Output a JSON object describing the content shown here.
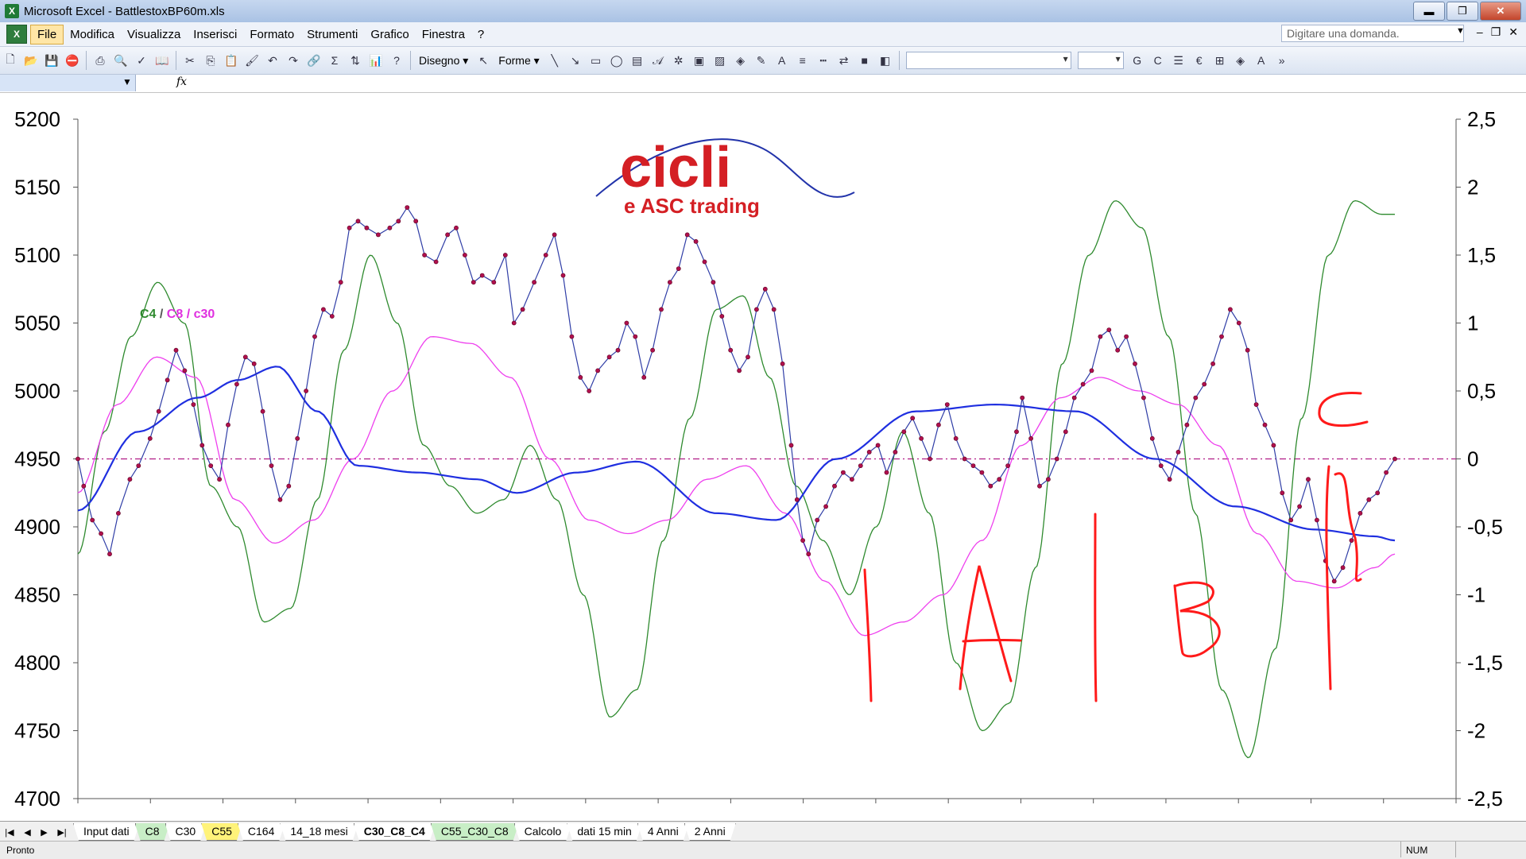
{
  "window": {
    "title": "Microsoft Excel - BattlestoxBP60m.xls",
    "app_icon": "excel-icon",
    "buttons": {
      "minimize": "▬",
      "restore": "❐",
      "close": "✕"
    }
  },
  "menu": {
    "items": [
      "File",
      "Modifica",
      "Visualizza",
      "Inserisci",
      "Formato",
      "Strumenti",
      "Grafico",
      "Finestra",
      "?"
    ],
    "active": "File",
    "ask_placeholder": "Digitare una domanda.",
    "mdi": {
      "minimize": "–",
      "restore": "❐",
      "close": "✕"
    }
  },
  "toolbar": {
    "disegno": "Disegno ▾",
    "forme": "Forme ▾",
    "bold": "G",
    "italic": "C",
    "euro": "€"
  },
  "formula_bar": {
    "fx": "fx"
  },
  "chart_data": {
    "type": "line",
    "logo": {
      "big": "cicli",
      "small": "e ASC trading"
    },
    "legend": {
      "c4": "C4",
      "slash1": " / ",
      "c8": "C8",
      "slash2": " / ",
      "c30": "c30"
    },
    "y_left": {
      "min": 4700,
      "max": 5200,
      "ticks": [
        "5200",
        "5150",
        "5100",
        "5050",
        "5000",
        "4950",
        "4900",
        "4850",
        "4800",
        "4750",
        "4700"
      ]
    },
    "y_right": {
      "min": -2.5,
      "max": 2.5,
      "ticks": [
        "2,5",
        "2",
        "1,5",
        "1",
        "0,5",
        "0",
        "-0,5",
        "-1",
        "-1,5",
        "-2",
        "-2,5"
      ]
    },
    "x_count": 19,
    "colors": {
      "price": "#2f3da6",
      "marker": "#b0104d",
      "c4": "#2e8a2e",
      "c8": "#ee3fee",
      "c30": "#1f2fe0",
      "zero": "#b11b86",
      "annot": "#ff1a1a"
    },
    "annotations": {
      "a": "A",
      "b": "B",
      "c": "C"
    },
    "price_keyframes": [
      [
        0,
        4950
      ],
      [
        2,
        4930
      ],
      [
        5,
        4905
      ],
      [
        8,
        4895
      ],
      [
        11,
        4880
      ],
      [
        14,
        4910
      ],
      [
        18,
        4935
      ],
      [
        21,
        4945
      ],
      [
        25,
        4965
      ],
      [
        28,
        4985
      ],
      [
        31,
        5008
      ],
      [
        34,
        5030
      ],
      [
        37,
        5015
      ],
      [
        40,
        4990
      ],
      [
        43,
        4960
      ],
      [
        46,
        4945
      ],
      [
        49,
        4935
      ],
      [
        52,
        4975
      ],
      [
        55,
        5005
      ],
      [
        58,
        5025
      ],
      [
        61,
        5020
      ],
      [
        64,
        4985
      ],
      [
        67,
        4945
      ],
      [
        70,
        4920
      ],
      [
        73,
        4930
      ],
      [
        76,
        4965
      ],
      [
        79,
        5000
      ],
      [
        82,
        5040
      ],
      [
        85,
        5060
      ],
      [
        88,
        5055
      ],
      [
        91,
        5080
      ],
      [
        94,
        5120
      ],
      [
        97,
        5125
      ],
      [
        100,
        5120
      ],
      [
        104,
        5115
      ],
      [
        108,
        5120
      ],
      [
        111,
        5125
      ],
      [
        114,
        5135
      ],
      [
        117,
        5125
      ],
      [
        120,
        5100
      ],
      [
        124,
        5095
      ],
      [
        128,
        5115
      ],
      [
        131,
        5120
      ],
      [
        134,
        5100
      ],
      [
        137,
        5080
      ],
      [
        140,
        5085
      ],
      [
        144,
        5080
      ],
      [
        148,
        5100
      ],
      [
        151,
        5050
      ],
      [
        154,
        5060
      ],
      [
        158,
        5080
      ],
      [
        162,
        5100
      ],
      [
        165,
        5115
      ],
      [
        168,
        5085
      ],
      [
        171,
        5040
      ],
      [
        174,
        5010
      ],
      [
        177,
        5000
      ],
      [
        180,
        5015
      ],
      [
        184,
        5025
      ],
      [
        187,
        5030
      ],
      [
        190,
        5050
      ],
      [
        193,
        5040
      ],
      [
        196,
        5010
      ],
      [
        199,
        5030
      ],
      [
        202,
        5060
      ],
      [
        205,
        5080
      ],
      [
        208,
        5090
      ],
      [
        211,
        5115
      ],
      [
        214,
        5110
      ],
      [
        217,
        5095
      ],
      [
        220,
        5080
      ],
      [
        223,
        5055
      ],
      [
        226,
        5030
      ],
      [
        229,
        5015
      ],
      [
        232,
        5025
      ],
      [
        235,
        5060
      ],
      [
        238,
        5075
      ],
      [
        241,
        5060
      ],
      [
        244,
        5020
      ],
      [
        247,
        4960
      ],
      [
        249,
        4920
      ],
      [
        251,
        4890
      ],
      [
        253,
        4880
      ],
      [
        256,
        4905
      ],
      [
        259,
        4915
      ],
      [
        262,
        4930
      ],
      [
        265,
        4940
      ],
      [
        268,
        4935
      ],
      [
        271,
        4945
      ],
      [
        274,
        4955
      ],
      [
        277,
        4960
      ],
      [
        280,
        4940
      ],
      [
        283,
        4955
      ],
      [
        286,
        4970
      ],
      [
        289,
        4980
      ],
      [
        292,
        4965
      ],
      [
        295,
        4950
      ],
      [
        298,
        4975
      ],
      [
        301,
        4990
      ],
      [
        304,
        4965
      ],
      [
        307,
        4950
      ],
      [
        310,
        4945
      ],
      [
        313,
        4940
      ],
      [
        316,
        4930
      ],
      [
        319,
        4935
      ],
      [
        322,
        4945
      ],
      [
        325,
        4970
      ],
      [
        327,
        4995
      ],
      [
        330,
        4965
      ],
      [
        333,
        4930
      ],
      [
        336,
        4935
      ],
      [
        339,
        4950
      ],
      [
        342,
        4970
      ],
      [
        345,
        4995
      ],
      [
        348,
        5005
      ],
      [
        351,
        5015
      ],
      [
        354,
        5040
      ],
      [
        357,
        5045
      ],
      [
        360,
        5030
      ],
      [
        363,
        5040
      ],
      [
        366,
        5020
      ],
      [
        369,
        4995
      ],
      [
        372,
        4965
      ],
      [
        375,
        4945
      ],
      [
        378,
        4935
      ],
      [
        381,
        4955
      ],
      [
        384,
        4975
      ],
      [
        387,
        4995
      ],
      [
        390,
        5005
      ],
      [
        393,
        5020
      ],
      [
        396,
        5040
      ],
      [
        399,
        5060
      ],
      [
        402,
        5050
      ],
      [
        405,
        5030
      ],
      [
        408,
        4990
      ],
      [
        411,
        4975
      ],
      [
        414,
        4960
      ],
      [
        417,
        4925
      ],
      [
        420,
        4905
      ],
      [
        423,
        4915
      ],
      [
        426,
        4935
      ],
      [
        429,
        4905
      ],
      [
        432,
        4875
      ],
      [
        435,
        4860
      ],
      [
        438,
        4870
      ],
      [
        441,
        4890
      ],
      [
        444,
        4910
      ],
      [
        447,
        4920
      ],
      [
        450,
        4925
      ],
      [
        453,
        4940
      ],
      [
        456,
        4950
      ]
    ],
    "c30_keyframes": [
      [
        0,
        4912
      ],
      [
        30,
        4970
      ],
      [
        60,
        4995
      ],
      [
        80,
        5008
      ],
      [
        100,
        5018
      ],
      [
        120,
        4985
      ],
      [
        140,
        4945
      ],
      [
        170,
        4940
      ],
      [
        200,
        4935
      ],
      [
        220,
        4925
      ],
      [
        250,
        4940
      ],
      [
        280,
        4948
      ],
      [
        320,
        4910
      ],
      [
        350,
        4905
      ],
      [
        380,
        4950
      ],
      [
        420,
        4985
      ],
      [
        460,
        4990
      ],
      [
        500,
        4985
      ],
      [
        540,
        4950
      ],
      [
        580,
        4915
      ],
      [
        620,
        4898
      ],
      [
        650,
        4893
      ],
      [
        660,
        4890
      ]
    ],
    "c8_keyframes": [
      [
        0,
        4925
      ],
      [
        20,
        4990
      ],
      [
        40,
        5025
      ],
      [
        60,
        5010
      ],
      [
        80,
        4920
      ],
      [
        100,
        4888
      ],
      [
        120,
        4905
      ],
      [
        140,
        4950
      ],
      [
        160,
        5000
      ],
      [
        180,
        5040
      ],
      [
        200,
        5035
      ],
      [
        220,
        5010
      ],
      [
        240,
        4950
      ],
      [
        260,
        4905
      ],
      [
        280,
        4895
      ],
      [
        300,
        4905
      ],
      [
        320,
        4935
      ],
      [
        340,
        4945
      ],
      [
        360,
        4910
      ],
      [
        380,
        4860
      ],
      [
        400,
        4820
      ],
      [
        420,
        4830
      ],
      [
        440,
        4850
      ],
      [
        460,
        4890
      ],
      [
        480,
        4960
      ],
      [
        500,
        4995
      ],
      [
        520,
        5010
      ],
      [
        540,
        5000
      ],
      [
        560,
        4990
      ],
      [
        580,
        4960
      ],
      [
        600,
        4895
      ],
      [
        620,
        4860
      ],
      [
        640,
        4855
      ],
      [
        660,
        4870
      ],
      [
        670,
        4880
      ]
    ],
    "c4_keyframes": [
      [
        0,
        -0.7
      ],
      [
        20,
        0.2
      ],
      [
        40,
        0.9
      ],
      [
        60,
        1.3
      ],
      [
        80,
        1.0
      ],
      [
        100,
        -0.2
      ],
      [
        120,
        -0.5
      ],
      [
        140,
        -1.2
      ],
      [
        160,
        -1.1
      ],
      [
        180,
        -0.3
      ],
      [
        200,
        0.8
      ],
      [
        220,
        1.5
      ],
      [
        240,
        1.0
      ],
      [
        260,
        0.1
      ],
      [
        280,
        -0.2
      ],
      [
        300,
        -0.4
      ],
      [
        320,
        -0.3
      ],
      [
        340,
        0.1
      ],
      [
        360,
        -0.3
      ],
      [
        380,
        -1.0
      ],
      [
        400,
        -1.9
      ],
      [
        420,
        -1.7
      ],
      [
        440,
        -0.6
      ],
      [
        460,
        0.3
      ],
      [
        480,
        1.1
      ],
      [
        500,
        1.2
      ],
      [
        520,
        0.6
      ],
      [
        540,
        -0.2
      ],
      [
        560,
        -0.6
      ],
      [
        580,
        -1.0
      ],
      [
        600,
        -0.5
      ],
      [
        620,
        0.2
      ],
      [
        640,
        -0.4
      ],
      [
        660,
        -1.5
      ],
      [
        680,
        -2.0
      ],
      [
        700,
        -1.8
      ],
      [
        720,
        -0.8
      ],
      [
        740,
        0.7
      ],
      [
        760,
        1.5
      ],
      [
        780,
        1.9
      ],
      [
        800,
        1.7
      ],
      [
        820,
        0.9
      ],
      [
        840,
        -0.4
      ],
      [
        860,
        -1.7
      ],
      [
        880,
        -2.2
      ],
      [
        900,
        -1.4
      ],
      [
        920,
        0.3
      ],
      [
        940,
        1.5
      ],
      [
        960,
        1.9
      ],
      [
        980,
        1.8
      ],
      [
        990,
        1.8
      ]
    ]
  },
  "sheet_tabs": [
    {
      "label": "Input dati",
      "style": ""
    },
    {
      "label": "C8",
      "style": "green"
    },
    {
      "label": "C30",
      "style": ""
    },
    {
      "label": "C55",
      "style": "yellow"
    },
    {
      "label": "C164",
      "style": ""
    },
    {
      "label": "14_18 mesi",
      "style": ""
    },
    {
      "label": "C30_C8_C4",
      "style": "active"
    },
    {
      "label": "C55_C30_C8",
      "style": "green"
    },
    {
      "label": "Calcolo",
      "style": ""
    },
    {
      "label": "dati 15 min",
      "style": ""
    },
    {
      "label": "4 Anni",
      "style": ""
    },
    {
      "label": "2 Anni",
      "style": ""
    }
  ],
  "tab_nav": [
    "|◀",
    "◀",
    "▶",
    "▶|"
  ],
  "status": {
    "ready": "Pronto",
    "num": "NUM"
  }
}
